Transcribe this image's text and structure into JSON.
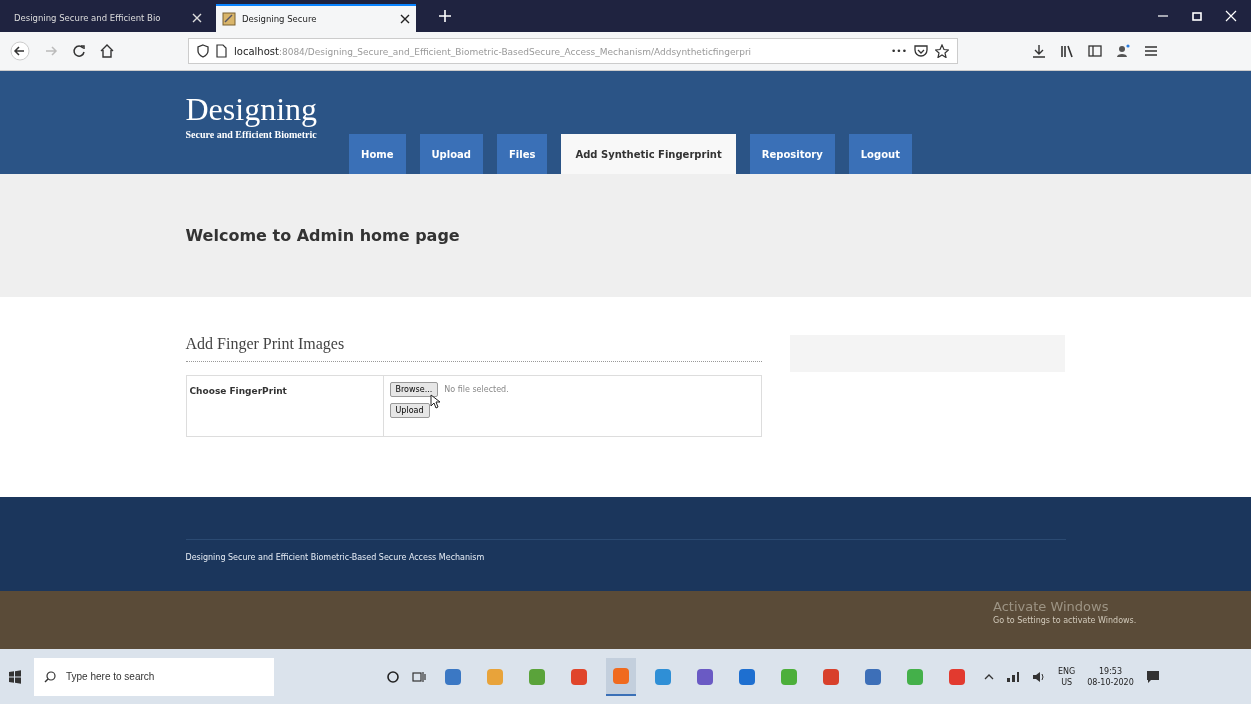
{
  "browser": {
    "tabs": [
      {
        "title": "Designing Secure and Efficient Bio",
        "selected": false
      },
      {
        "title": "Designing Secure",
        "selected": true
      }
    ],
    "url_host": "localhost",
    "url_path": ":8084/Designing_Secure_and_Efficient_Biometric-BasedSecure_Access_Mechanism/Addsyntheticfingerpri",
    "url_more": "•••"
  },
  "site": {
    "title": "Designing",
    "subtitle": "Secure and Efficient Biometric",
    "nav": [
      {
        "label": "Home",
        "selected": false
      },
      {
        "label": "Upload",
        "selected": false
      },
      {
        "label": "Files",
        "selected": false
      },
      {
        "label": "Add Synthetic Fingerprint",
        "selected": true
      },
      {
        "label": "Repository",
        "selected": false
      },
      {
        "label": "Logout",
        "selected": false
      }
    ],
    "welcome": "Welcome to Admin home page",
    "form": {
      "heading": "Add Finger Print Images",
      "label": "Choose FingerPrint",
      "browse": "Browse...",
      "file_status": "No file selected.",
      "submit": "Upload"
    },
    "footer": "Designing Secure and Efficient Biometric-Based Secure Access Mechanism"
  },
  "watermark_os": {
    "title": "Activate Windows",
    "note": "Go to Settings to activate Windows."
  },
  "taskbar": {
    "search_placeholder": "Type here to search",
    "apps": [
      {
        "color": "#3b78c4",
        "selected": false
      },
      {
        "color": "#e8a33a",
        "selected": false
      },
      {
        "color": "#5aa33a",
        "selected": false
      },
      {
        "color": "#e0452b",
        "selected": false
      },
      {
        "color": "#f06a1e",
        "selected": true
      },
      {
        "color": "#2f8fd6",
        "selected": false
      },
      {
        "color": "#6a5ac4",
        "selected": false
      },
      {
        "color": "#1e6fd0",
        "selected": false
      },
      {
        "color": "#4caf3a",
        "selected": false
      },
      {
        "color": "#d8402b",
        "selected": false
      },
      {
        "color": "#3d6fb8",
        "selected": false
      },
      {
        "color": "#44b04a",
        "selected": false
      },
      {
        "color": "#e23a2f",
        "selected": false
      }
    ],
    "lang": "ENG",
    "region": "US",
    "time": "19:53",
    "date": "08-10-2020"
  }
}
